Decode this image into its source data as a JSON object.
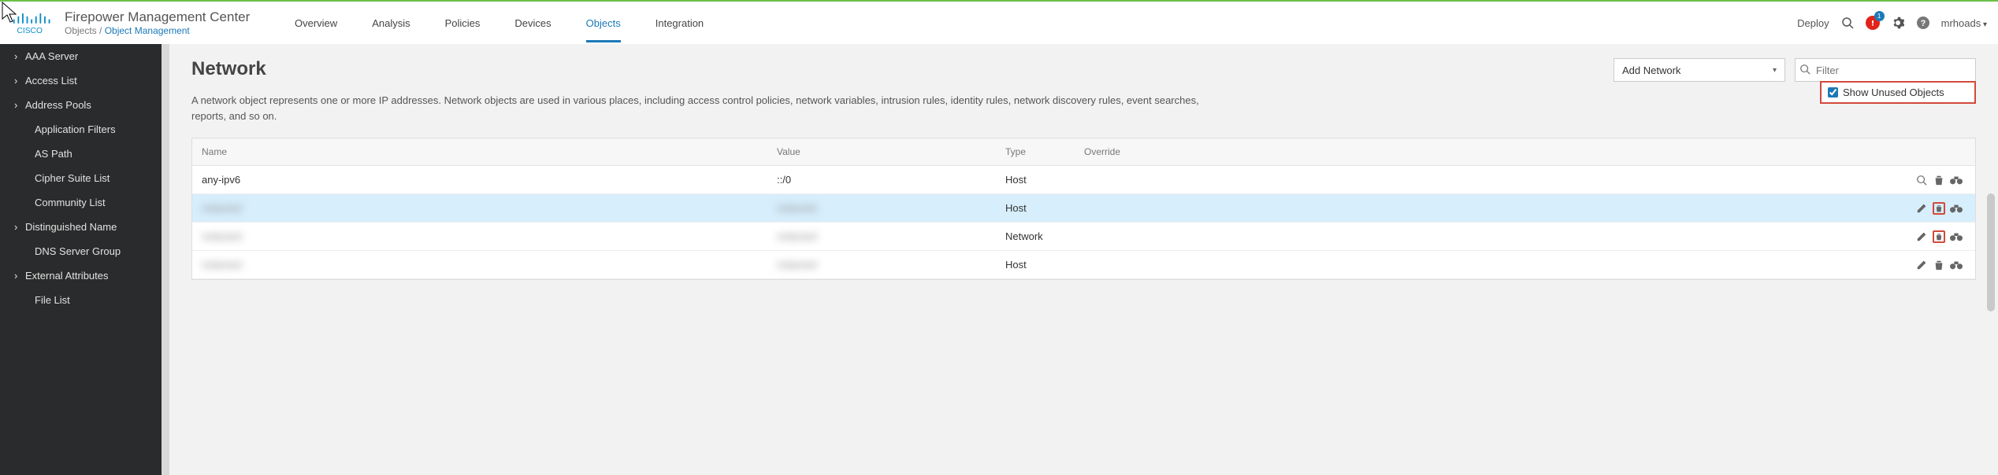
{
  "app_title": "Firepower Management Center",
  "breadcrumb": {
    "root": "Objects",
    "current": "Object Management"
  },
  "topnav": [
    "Overview",
    "Analysis",
    "Policies",
    "Devices",
    "Objects",
    "Integration"
  ],
  "topnav_active": "Objects",
  "deploy_label": "Deploy",
  "alert_badge": "1",
  "username": "mrhoads",
  "sidebar": [
    {
      "label": "AAA Server",
      "expandable": true
    },
    {
      "label": "Access List",
      "expandable": true
    },
    {
      "label": "Address Pools",
      "expandable": true
    },
    {
      "label": "Application Filters",
      "expandable": false
    },
    {
      "label": "AS Path",
      "expandable": false
    },
    {
      "label": "Cipher Suite List",
      "expandable": false
    },
    {
      "label": "Community List",
      "expandable": false
    },
    {
      "label": "Distinguished Name",
      "expandable": true
    },
    {
      "label": "DNS Server Group",
      "expandable": false
    },
    {
      "label": "External Attributes",
      "expandable": true
    },
    {
      "label": "File List",
      "expandable": false
    }
  ],
  "page": {
    "title": "Network",
    "description": "A network object represents one or more IP addresses. Network objects are used in various places, including access control policies, network variables, intrusion rules, identity rules, network discovery rules, event searches, reports, and so on.",
    "add_label": "Add Network",
    "filter_placeholder": "Filter",
    "show_unused_label": "Show Unused Objects"
  },
  "table": {
    "columns": [
      "Name",
      "Value",
      "Type",
      "Override"
    ],
    "rows": [
      {
        "name": "any-ipv6",
        "value": "::/0",
        "type": "Host",
        "actions": [
          "view",
          "delete",
          "binoculars"
        ],
        "hl": false,
        "blur": false,
        "del_hl": false
      },
      {
        "name": "redacted",
        "value": "redacted",
        "type": "Host",
        "actions": [
          "edit",
          "delete",
          "binoculars"
        ],
        "hl": true,
        "blur": true,
        "del_hl": true
      },
      {
        "name": "redacted",
        "value": "redacted",
        "type": "Network",
        "actions": [
          "edit",
          "delete",
          "binoculars"
        ],
        "hl": false,
        "blur": true,
        "del_hl": true
      },
      {
        "name": "redacted",
        "value": "redacted",
        "type": "Host",
        "actions": [
          "edit",
          "delete",
          "binoculars"
        ],
        "hl": false,
        "blur": true,
        "del_hl": false
      }
    ]
  }
}
